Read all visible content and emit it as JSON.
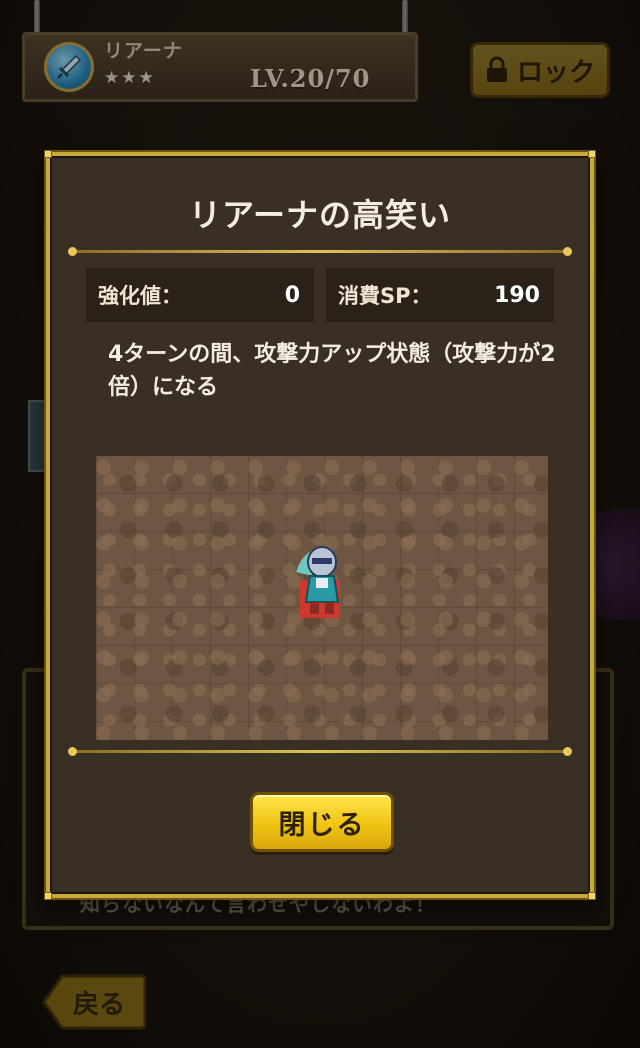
{
  "header": {
    "character_name": "リアーナ",
    "stars": "★★★",
    "level": "LV.20/70",
    "lock_label": "ロック"
  },
  "background": {
    "obscured_text": "知らないなんて言わせやしないわよ！",
    "back_label": "戻る"
  },
  "modal": {
    "title": "リアーナの高笑い",
    "enhance_label": "強化値：",
    "enhance_value": "0",
    "sp_label": "消費SP：",
    "sp_value": "190",
    "description": "4ターンの間、攻撃力アップ状態（攻撃力が2倍）になる",
    "close_label": "閉じる"
  },
  "colors": {
    "gold_border": "#c9a93a",
    "panel_bg": "#3a2f24",
    "button_yellow": "#f0c414",
    "target_tile": "#d8352c"
  },
  "icons": {
    "weapon": "sword-icon",
    "lock": "padlock-icon"
  }
}
